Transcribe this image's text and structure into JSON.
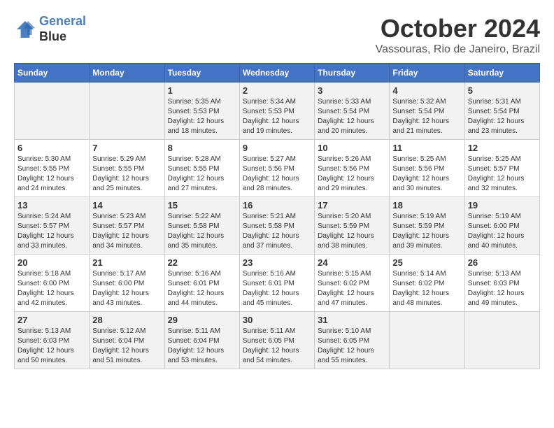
{
  "header": {
    "logo_line1": "General",
    "logo_line2": "Blue",
    "month": "October 2024",
    "location": "Vassouras, Rio de Janeiro, Brazil"
  },
  "days_of_week": [
    "Sunday",
    "Monday",
    "Tuesday",
    "Wednesday",
    "Thursday",
    "Friday",
    "Saturday"
  ],
  "weeks": [
    [
      {
        "day": "",
        "sunrise": "",
        "sunset": "",
        "daylight": ""
      },
      {
        "day": "",
        "sunrise": "",
        "sunset": "",
        "daylight": ""
      },
      {
        "day": "1",
        "sunrise": "Sunrise: 5:35 AM",
        "sunset": "Sunset: 5:53 PM",
        "daylight": "Daylight: 12 hours and 18 minutes."
      },
      {
        "day": "2",
        "sunrise": "Sunrise: 5:34 AM",
        "sunset": "Sunset: 5:53 PM",
        "daylight": "Daylight: 12 hours and 19 minutes."
      },
      {
        "day": "3",
        "sunrise": "Sunrise: 5:33 AM",
        "sunset": "Sunset: 5:54 PM",
        "daylight": "Daylight: 12 hours and 20 minutes."
      },
      {
        "day": "4",
        "sunrise": "Sunrise: 5:32 AM",
        "sunset": "Sunset: 5:54 PM",
        "daylight": "Daylight: 12 hours and 21 minutes."
      },
      {
        "day": "5",
        "sunrise": "Sunrise: 5:31 AM",
        "sunset": "Sunset: 5:54 PM",
        "daylight": "Daylight: 12 hours and 23 minutes."
      }
    ],
    [
      {
        "day": "6",
        "sunrise": "Sunrise: 5:30 AM",
        "sunset": "Sunset: 5:55 PM",
        "daylight": "Daylight: 12 hours and 24 minutes."
      },
      {
        "day": "7",
        "sunrise": "Sunrise: 5:29 AM",
        "sunset": "Sunset: 5:55 PM",
        "daylight": "Daylight: 12 hours and 25 minutes."
      },
      {
        "day": "8",
        "sunrise": "Sunrise: 5:28 AM",
        "sunset": "Sunset: 5:55 PM",
        "daylight": "Daylight: 12 hours and 27 minutes."
      },
      {
        "day": "9",
        "sunrise": "Sunrise: 5:27 AM",
        "sunset": "Sunset: 5:56 PM",
        "daylight": "Daylight: 12 hours and 28 minutes."
      },
      {
        "day": "10",
        "sunrise": "Sunrise: 5:26 AM",
        "sunset": "Sunset: 5:56 PM",
        "daylight": "Daylight: 12 hours and 29 minutes."
      },
      {
        "day": "11",
        "sunrise": "Sunrise: 5:25 AM",
        "sunset": "Sunset: 5:56 PM",
        "daylight": "Daylight: 12 hours and 30 minutes."
      },
      {
        "day": "12",
        "sunrise": "Sunrise: 5:25 AM",
        "sunset": "Sunset: 5:57 PM",
        "daylight": "Daylight: 12 hours and 32 minutes."
      }
    ],
    [
      {
        "day": "13",
        "sunrise": "Sunrise: 5:24 AM",
        "sunset": "Sunset: 5:57 PM",
        "daylight": "Daylight: 12 hours and 33 minutes."
      },
      {
        "day": "14",
        "sunrise": "Sunrise: 5:23 AM",
        "sunset": "Sunset: 5:57 PM",
        "daylight": "Daylight: 12 hours and 34 minutes."
      },
      {
        "day": "15",
        "sunrise": "Sunrise: 5:22 AM",
        "sunset": "Sunset: 5:58 PM",
        "daylight": "Daylight: 12 hours and 35 minutes."
      },
      {
        "day": "16",
        "sunrise": "Sunrise: 5:21 AM",
        "sunset": "Sunset: 5:58 PM",
        "daylight": "Daylight: 12 hours and 37 minutes."
      },
      {
        "day": "17",
        "sunrise": "Sunrise: 5:20 AM",
        "sunset": "Sunset: 5:59 PM",
        "daylight": "Daylight: 12 hours and 38 minutes."
      },
      {
        "day": "18",
        "sunrise": "Sunrise: 5:19 AM",
        "sunset": "Sunset: 5:59 PM",
        "daylight": "Daylight: 12 hours and 39 minutes."
      },
      {
        "day": "19",
        "sunrise": "Sunrise: 5:19 AM",
        "sunset": "Sunset: 6:00 PM",
        "daylight": "Daylight: 12 hours and 40 minutes."
      }
    ],
    [
      {
        "day": "20",
        "sunrise": "Sunrise: 5:18 AM",
        "sunset": "Sunset: 6:00 PM",
        "daylight": "Daylight: 12 hours and 42 minutes."
      },
      {
        "day": "21",
        "sunrise": "Sunrise: 5:17 AM",
        "sunset": "Sunset: 6:00 PM",
        "daylight": "Daylight: 12 hours and 43 minutes."
      },
      {
        "day": "22",
        "sunrise": "Sunrise: 5:16 AM",
        "sunset": "Sunset: 6:01 PM",
        "daylight": "Daylight: 12 hours and 44 minutes."
      },
      {
        "day": "23",
        "sunrise": "Sunrise: 5:16 AM",
        "sunset": "Sunset: 6:01 PM",
        "daylight": "Daylight: 12 hours and 45 minutes."
      },
      {
        "day": "24",
        "sunrise": "Sunrise: 5:15 AM",
        "sunset": "Sunset: 6:02 PM",
        "daylight": "Daylight: 12 hours and 47 minutes."
      },
      {
        "day": "25",
        "sunrise": "Sunrise: 5:14 AM",
        "sunset": "Sunset: 6:02 PM",
        "daylight": "Daylight: 12 hours and 48 minutes."
      },
      {
        "day": "26",
        "sunrise": "Sunrise: 5:13 AM",
        "sunset": "Sunset: 6:03 PM",
        "daylight": "Daylight: 12 hours and 49 minutes."
      }
    ],
    [
      {
        "day": "27",
        "sunrise": "Sunrise: 5:13 AM",
        "sunset": "Sunset: 6:03 PM",
        "daylight": "Daylight: 12 hours and 50 minutes."
      },
      {
        "day": "28",
        "sunrise": "Sunrise: 5:12 AM",
        "sunset": "Sunset: 6:04 PM",
        "daylight": "Daylight: 12 hours and 51 minutes."
      },
      {
        "day": "29",
        "sunrise": "Sunrise: 5:11 AM",
        "sunset": "Sunset: 6:04 PM",
        "daylight": "Daylight: 12 hours and 53 minutes."
      },
      {
        "day": "30",
        "sunrise": "Sunrise: 5:11 AM",
        "sunset": "Sunset: 6:05 PM",
        "daylight": "Daylight: 12 hours and 54 minutes."
      },
      {
        "day": "31",
        "sunrise": "Sunrise: 5:10 AM",
        "sunset": "Sunset: 6:05 PM",
        "daylight": "Daylight: 12 hours and 55 minutes."
      },
      {
        "day": "",
        "sunrise": "",
        "sunset": "",
        "daylight": ""
      },
      {
        "day": "",
        "sunrise": "",
        "sunset": "",
        "daylight": ""
      }
    ]
  ]
}
